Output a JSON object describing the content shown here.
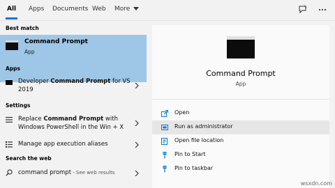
{
  "tabs": [
    {
      "label": "All",
      "active": true
    },
    {
      "label": "Apps"
    },
    {
      "label": "Documents"
    },
    {
      "label": "Web"
    },
    {
      "label": "More"
    }
  ],
  "toolbar": {
    "feedback_icon": "feedback-icon",
    "more_icon": "ellipsis-icon"
  },
  "left": {
    "best_match_label": "Best match",
    "best_match": {
      "title": "Command Prompt",
      "subtitle": "App",
      "icon": "command-prompt-icon"
    },
    "apps_label": "Apps",
    "apps": [
      {
        "text_prefix": "Developer ",
        "text_bold": "Command Prompt",
        "text_suffix": " for VS 2019"
      }
    ],
    "settings_label": "Settings",
    "settings": [
      {
        "text_prefix": "Replace ",
        "text_bold": "Command Prompt",
        "text_suffix": " with Windows PowerShell in the Win + X"
      },
      {
        "text_prefix": "Manage app execution aliases",
        "text_bold": "",
        "text_suffix": ""
      }
    ],
    "web_label": "Search the web",
    "web": {
      "query": "command prompt",
      "suffix": " - See web results"
    }
  },
  "detail": {
    "title": "Command Prompt",
    "subtitle": "App",
    "actions": [
      {
        "label": "Open",
        "icon": "open-icon"
      },
      {
        "label": "Run as administrator",
        "icon": "shield-icon",
        "highlighted": true
      },
      {
        "label": "Open file location",
        "icon": "folder-icon"
      },
      {
        "label": "Pin to Start",
        "icon": "pin-icon"
      },
      {
        "label": "Pin to taskbar",
        "icon": "pin-icon"
      }
    ]
  },
  "watermark": "wsxdn.com",
  "colors": {
    "accent": "#0078d7",
    "selection": "#9ec6e6",
    "panel_bg": "#f2f2f2",
    "detail_bg": "#fafafa"
  }
}
